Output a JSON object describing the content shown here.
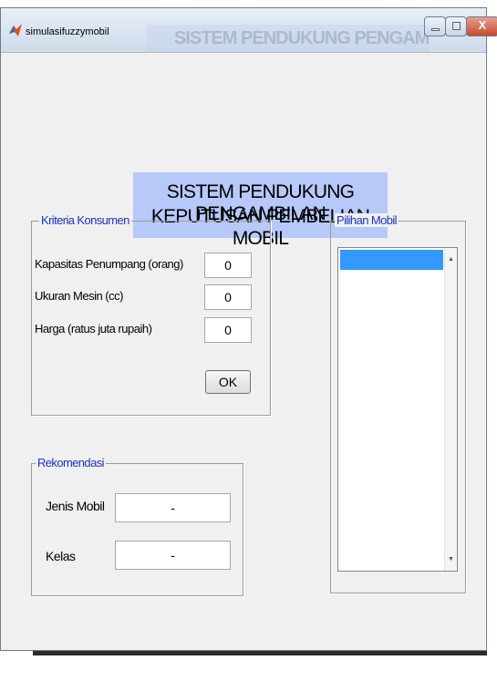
{
  "window": {
    "title": "simulasifuzzymobil",
    "background_title": "SISTEM PENDUKUNG PENGAMBILAN"
  },
  "heading": {
    "line1": "SISTEM PENDUKUNG PENGAMBILAN",
    "line2": "KEPUTUSAN PEMBELIAN MOBIL"
  },
  "kriteria": {
    "title": "Kriteria Konsumen",
    "kapasitas_label": "Kapasitas Penumpang (orang)",
    "kapasitas_value": "0",
    "mesin_label": "Ukuran Mesin (cc)",
    "mesin_value": "0",
    "harga_label": "Harga (ratus juta rupaih)",
    "harga_value": "0",
    "ok_label": "OK"
  },
  "rekomendasi": {
    "title": "Rekomendasi",
    "jenis_label": "Jenis Mobil",
    "jenis_value": "-",
    "kelas_label": "Kelas",
    "kelas_value": "-"
  },
  "pilihan": {
    "title": "Pilihan Mobil"
  },
  "colors": {
    "heading_bg": "#b7c9f9",
    "legend_text": "#1a33cc",
    "list_selection": "#3399ff",
    "close_button": "#c44a2f"
  },
  "icons": [
    "matlab-app-icon",
    "minimize-icon",
    "maximize-icon",
    "close-icon",
    "scroll-up-arrow-icon",
    "scroll-down-arrow-icon"
  ]
}
